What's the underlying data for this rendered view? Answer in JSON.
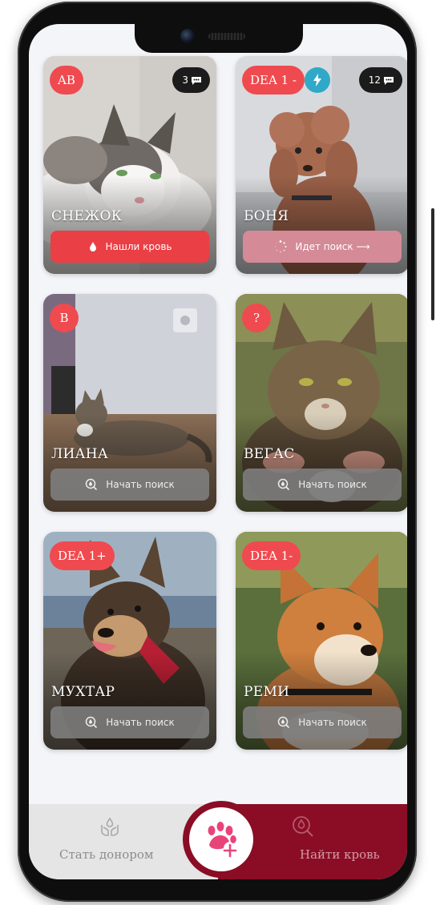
{
  "pets": [
    {
      "name": "СНЕЖОК",
      "blood_type": "AB",
      "comments": "3",
      "action": "Нашли кровь",
      "action_state": "found"
    },
    {
      "name": "БОНЯ",
      "blood_type": "DEA 1 -",
      "comments": "12",
      "action": "Идет поиск ⟶",
      "action_state": "searching",
      "urgent": true
    },
    {
      "name": "ЛИАНА",
      "blood_type": "B",
      "action": "Начать поиск",
      "action_state": "idle"
    },
    {
      "name": "ВЕГАС",
      "blood_type": "?",
      "action": "Начать поиск",
      "action_state": "idle"
    },
    {
      "name": "МУХТАР",
      "blood_type": "DEA 1+",
      "action": "Начать поиск",
      "action_state": "idle"
    },
    {
      "name": "РЕМИ",
      "blood_type": "DEA 1-",
      "action": "Начать поиск",
      "action_state": "idle"
    }
  ],
  "nav": {
    "donor_label": "Стать донором",
    "find_label": "Найти кровь",
    "add_pet_icon": "paw-plus-icon"
  },
  "colors": {
    "accent_red": "#ef4a4f",
    "nav_burgundy": "#8a0d25",
    "bolt_blue": "#2fa9c7"
  }
}
